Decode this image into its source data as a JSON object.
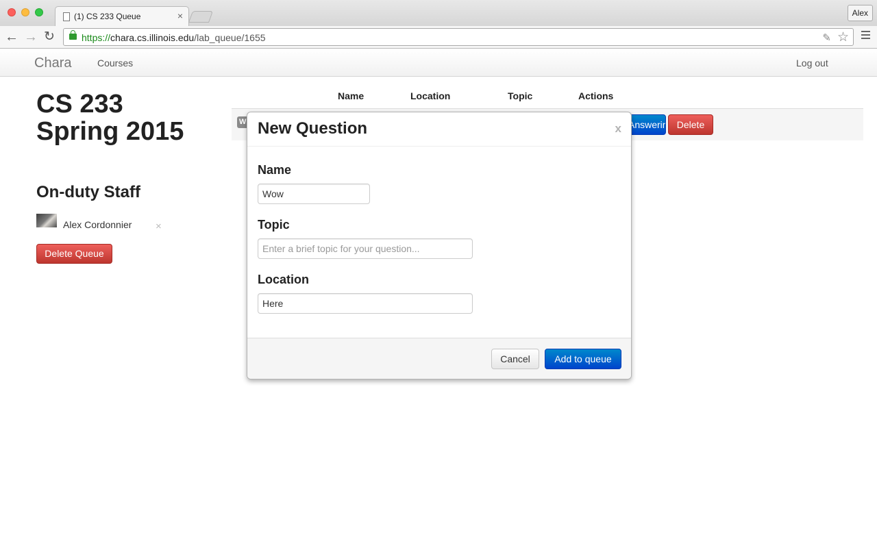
{
  "browser": {
    "tab_title": "(1) CS 233 Queue",
    "tab_close": "×",
    "profile_name": "Alex",
    "url_scheme": "https://",
    "url_host": "chara.cs.illinois.edu",
    "url_path": "/lab_queue/1655"
  },
  "navbar": {
    "brand": "Chara",
    "courses": "Courses",
    "logout": "Log out"
  },
  "course": {
    "title": "CS 233 Spring 2015"
  },
  "staff": {
    "heading": "On-duty Staff",
    "members": [
      {
        "name": "Alex Cordonnier",
        "remove": "×"
      }
    ],
    "delete_queue": "Delete Queue"
  },
  "table": {
    "headers": {
      "name": "Name",
      "location": "Location",
      "topic": "Topic",
      "actions": "Actions"
    },
    "rows": [
      {
        "badge": "W",
        "answer_button": "Answering!",
        "delete_button": "Delete"
      }
    ]
  },
  "modal": {
    "title": "New Question",
    "close": "x",
    "name_label": "Name",
    "name_value": "Wow",
    "topic_label": "Topic",
    "topic_placeholder": "Enter a brief topic for your question...",
    "topic_value": "",
    "location_label": "Location",
    "location_value": "Here",
    "cancel": "Cancel",
    "submit": "Add to queue"
  }
}
